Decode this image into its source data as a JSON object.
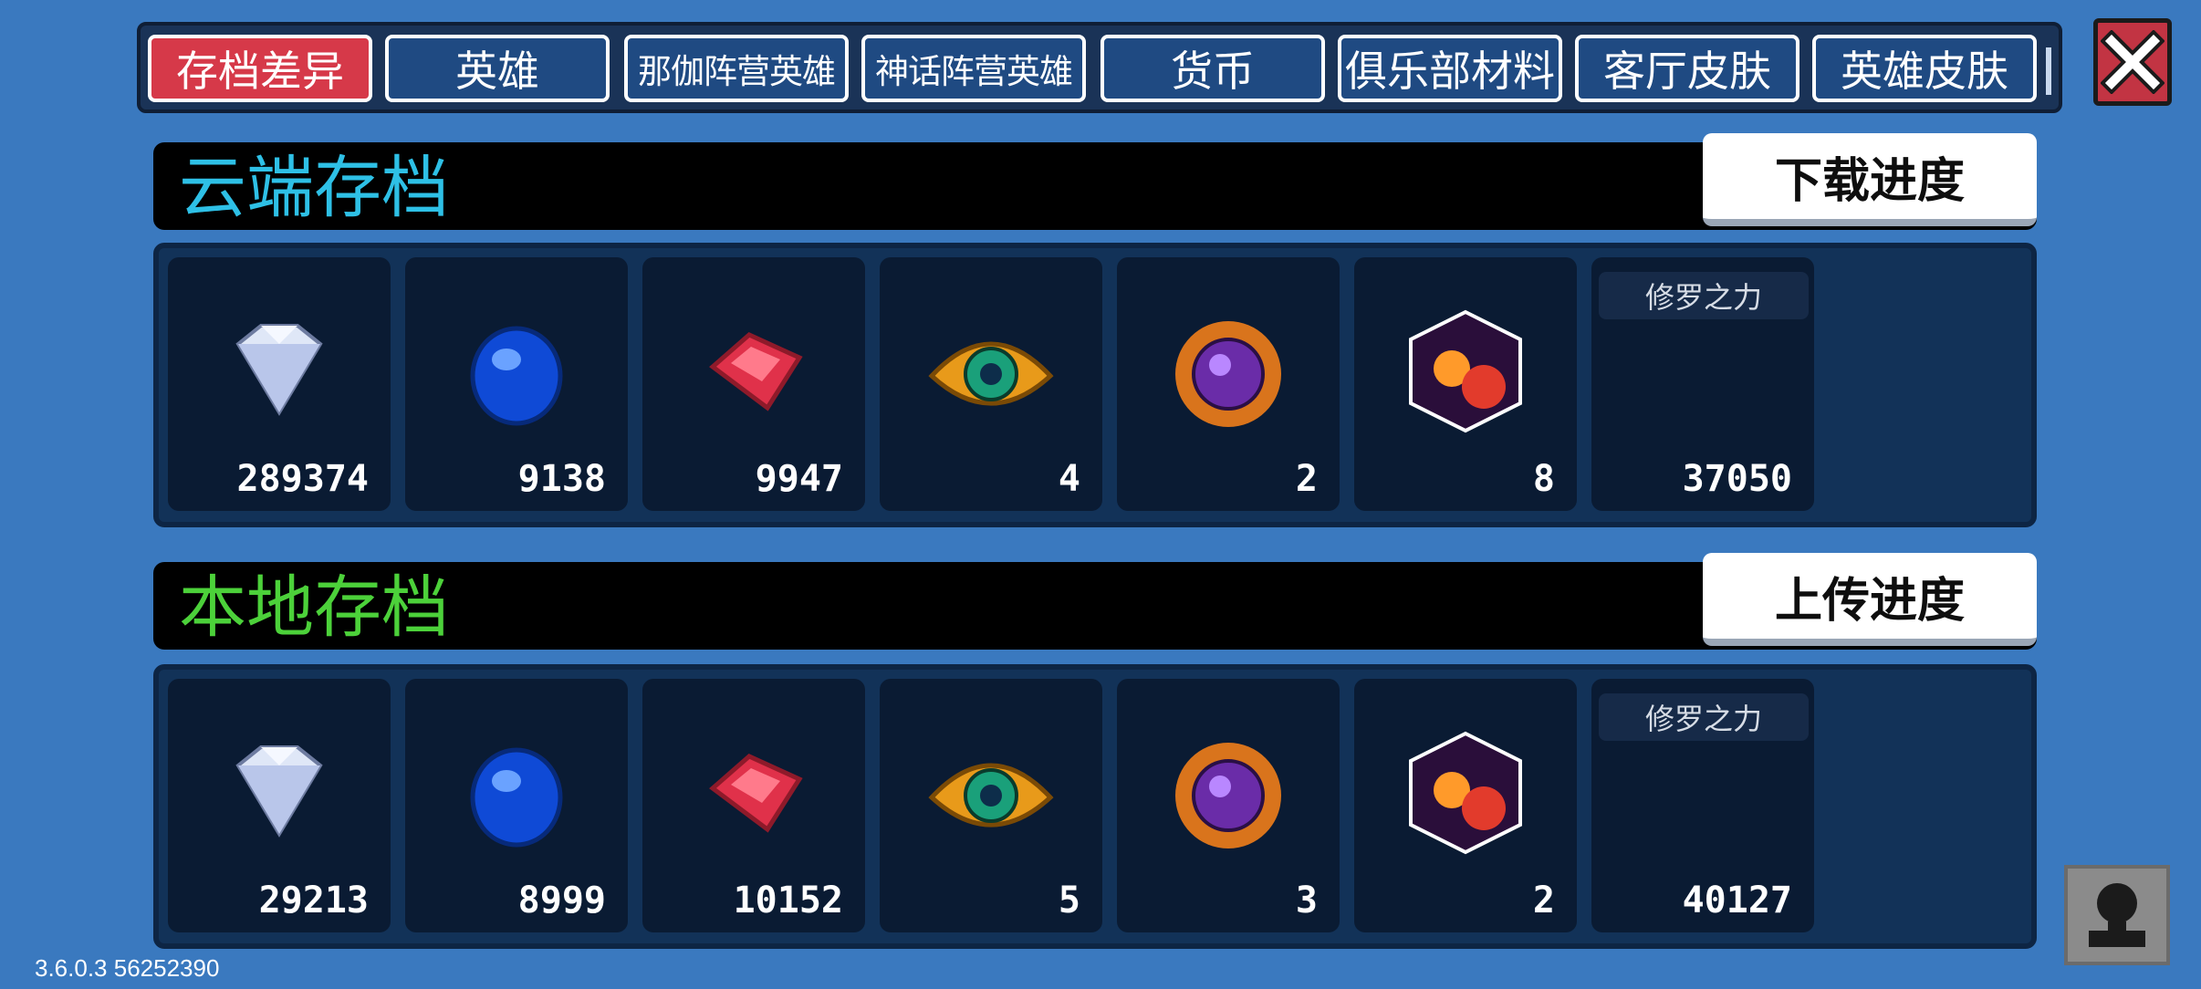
{
  "tabs": [
    {
      "label": "存档差异",
      "active": true
    },
    {
      "label": "英雄",
      "active": false
    },
    {
      "label": "那伽阵营英雄",
      "active": false
    },
    {
      "label": "神话阵营英雄",
      "active": false
    },
    {
      "label": "货币",
      "active": false
    },
    {
      "label": "俱乐部材料",
      "active": false
    },
    {
      "label": "客厅皮肤",
      "active": false
    },
    {
      "label": "英雄皮肤",
      "active": false
    }
  ],
  "cloud": {
    "title": "云端存档",
    "title_color": "#2ec0e6",
    "button_label": "下载进度",
    "items": [
      {
        "icon": "diamond-icon",
        "value": "289374"
      },
      {
        "icon": "blue-gem-icon",
        "value": "9138"
      },
      {
        "icon": "red-gem-icon",
        "value": "9947"
      },
      {
        "icon": "golden-eye-icon",
        "value": "4"
      },
      {
        "icon": "purple-orb-icon",
        "value": "2"
      },
      {
        "icon": "magic-cube-icon",
        "value": "8"
      },
      {
        "icon": "asura-power",
        "label": "修罗之力",
        "value": "37050"
      }
    ]
  },
  "local": {
    "title": "本地存档",
    "title_color": "#4cd13a",
    "button_label": "上传进度",
    "items": [
      {
        "icon": "diamond-icon",
        "value": "29213"
      },
      {
        "icon": "blue-gem-icon",
        "value": "8999"
      },
      {
        "icon": "red-gem-icon",
        "value": "10152"
      },
      {
        "icon": "golden-eye-icon",
        "value": "5"
      },
      {
        "icon": "purple-orb-icon",
        "value": "3"
      },
      {
        "icon": "magic-cube-icon",
        "value": "2"
      },
      {
        "icon": "asura-power",
        "label": "修罗之力",
        "value": "40127"
      }
    ]
  },
  "version": "3.6.0.3 56252390"
}
